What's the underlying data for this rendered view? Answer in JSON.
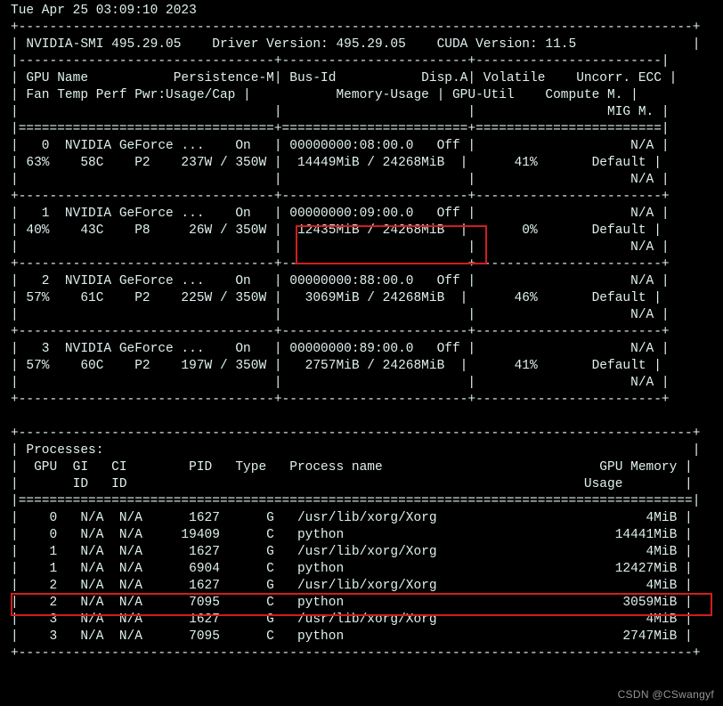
{
  "timestamp": "Tue Apr 25 03:09:10 2023",
  "driver": {
    "smi_version": "495.29.05",
    "driver_version": "495.29.05",
    "cuda_version": "11.5"
  },
  "headers": {
    "gpu": "GPU",
    "name": "Name",
    "persistence": "Persistence-M",
    "fan": "Fan",
    "temp": "Temp",
    "perf": "Perf",
    "pwr": "Pwr:Usage/Cap",
    "busid": "Bus-Id",
    "disp": "Disp.A",
    "memuse": "Memory-Usage",
    "vol": "Volatile",
    "uncorr": "Uncorr. ECC",
    "gpuutil": "GPU-Util",
    "compute": "Compute M.",
    "mig": "MIG M."
  },
  "gpus": [
    {
      "idx": 0,
      "name": "NVIDIA GeForce ...",
      "persist": "On",
      "fan": "63%",
      "temp": "58C",
      "perf": "P2",
      "pwr_use": "237W",
      "pwr_cap": "350W",
      "bus": "00000000:08:00.0",
      "disp": "Off",
      "mem_use": "14449MiB",
      "mem_cap": "24268MiB",
      "util": "41%",
      "ecc": "N/A",
      "compute": "Default",
      "mig": "N/A"
    },
    {
      "idx": 1,
      "name": "NVIDIA GeForce ...",
      "persist": "On",
      "fan": "40%",
      "temp": "43C",
      "perf": "P8",
      "pwr_use": "26W",
      "pwr_cap": "350W",
      "bus": "00000000:09:00.0",
      "disp": "Off",
      "mem_use": "12435MiB",
      "mem_cap": "24268MiB",
      "util": "0%",
      "ecc": "N/A",
      "compute": "Default",
      "mig": "N/A"
    },
    {
      "idx": 2,
      "name": "NVIDIA GeForce ...",
      "persist": "On",
      "fan": "57%",
      "temp": "61C",
      "perf": "P2",
      "pwr_use": "225W",
      "pwr_cap": "350W",
      "bus": "00000000:88:00.0",
      "disp": "Off",
      "mem_use": "3069MiB",
      "mem_cap": "24268MiB",
      "util": "46%",
      "ecc": "N/A",
      "compute": "Default",
      "mig": "N/A"
    },
    {
      "idx": 3,
      "name": "NVIDIA GeForce ...",
      "persist": "On",
      "fan": "57%",
      "temp": "60C",
      "perf": "P2",
      "pwr_use": "197W",
      "pwr_cap": "350W",
      "bus": "00000000:89:00.0",
      "disp": "Off",
      "mem_use": "2757MiB",
      "mem_cap": "24268MiB",
      "util": "41%",
      "ecc": "N/A",
      "compute": "Default",
      "mig": "N/A"
    }
  ],
  "proc_headers": {
    "title": "Processes:",
    "gpu": "GPU",
    "gi": "GI",
    "ci": "CI",
    "pid": "PID",
    "type": "Type",
    "name": "Process name",
    "mem": "GPU Memory",
    "memsub": "Usage",
    "idsub": "ID"
  },
  "processes": [
    {
      "gpu": 0,
      "gi": "N/A",
      "ci": "N/A",
      "pid": 1627,
      "type": "G",
      "name": "/usr/lib/xorg/Xorg",
      "mem": "4MiB"
    },
    {
      "gpu": 0,
      "gi": "N/A",
      "ci": "N/A",
      "pid": 19409,
      "type": "C",
      "name": "python",
      "mem": "14441MiB"
    },
    {
      "gpu": 1,
      "gi": "N/A",
      "ci": "N/A",
      "pid": 1627,
      "type": "G",
      "name": "/usr/lib/xorg/Xorg",
      "mem": "4MiB"
    },
    {
      "gpu": 1,
      "gi": "N/A",
      "ci": "N/A",
      "pid": 6904,
      "type": "C",
      "name": "python",
      "mem": "12427MiB"
    },
    {
      "gpu": 2,
      "gi": "N/A",
      "ci": "N/A",
      "pid": 1627,
      "type": "G",
      "name": "/usr/lib/xorg/Xorg",
      "mem": "4MiB"
    },
    {
      "gpu": 2,
      "gi": "N/A",
      "ci": "N/A",
      "pid": 7095,
      "type": "C",
      "name": "python",
      "mem": "3059MiB"
    },
    {
      "gpu": 3,
      "gi": "N/A",
      "ci": "N/A",
      "pid": 1627,
      "type": "G",
      "name": "/usr/lib/xorg/Xorg",
      "mem": "4MiB"
    },
    {
      "gpu": 3,
      "gi": "N/A",
      "ci": "N/A",
      "pid": 7095,
      "type": "C",
      "name": "python",
      "mem": "2747MiB"
    }
  ],
  "watermark": "CSDN @CSwangyf"
}
